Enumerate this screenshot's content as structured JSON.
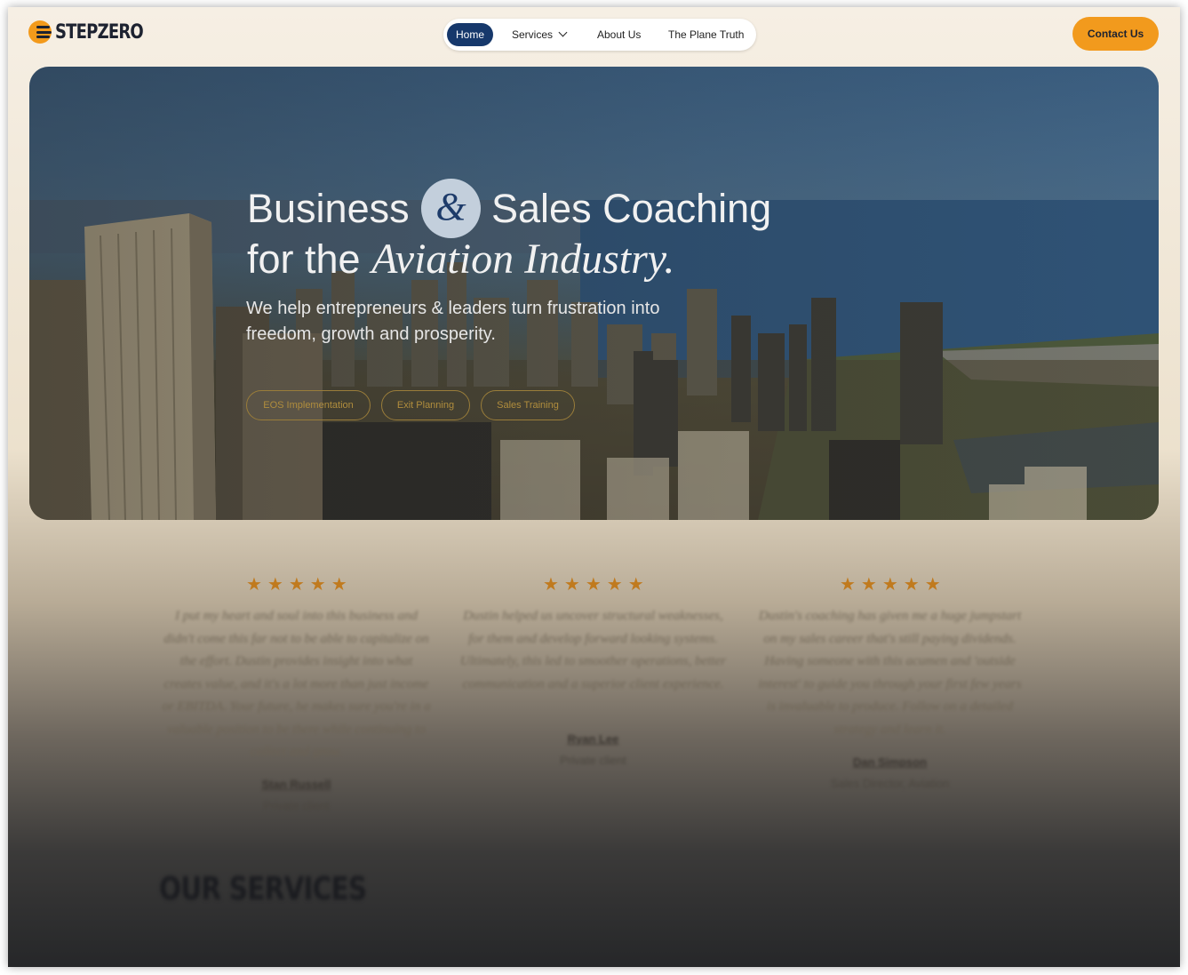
{
  "brand": {
    "name": "STEPZERO",
    "accent": "#f29a1d",
    "navy": "#16386b"
  },
  "nav": {
    "items": [
      {
        "label": "Home",
        "active": true
      },
      {
        "label": "Services",
        "has_dropdown": true
      },
      {
        "label": "About Us"
      },
      {
        "label": "The Plane Truth"
      }
    ]
  },
  "header": {
    "contact_label": "Contact Us"
  },
  "hero": {
    "line1_a": "Business",
    "ampersand": "&",
    "line1_b": "Sales Coaching",
    "line2_a": "for the",
    "line2_italic": "Aviation Industry.",
    "subtitle": "We help entrepreneurs & leaders turn frustration into freedom, growth and prosperity.",
    "pills": [
      "EOS Implementation",
      "Exit Planning",
      "Sales Training"
    ]
  },
  "testimonials": [
    {
      "stars": "★★★★★",
      "quote": "I put my heart and soul into this business and didn't come this far not to be able to capitalize on the effort. Dustin provides insight into what creates value, and it's a lot more than just income or EBITDA. Your future, he makes sure you're in a valuable position to be there while continuing to collect and grow.",
      "name": "Stan Russell",
      "role": "Private client"
    },
    {
      "stars": "★★★★★",
      "quote": "Dustin helped us uncover structural weaknesses, for them and develop forward looking systems. Ultimately, this led to smoother operations, better communication and a superior client experience.",
      "name": "Ryan Lee",
      "role": "Private client"
    },
    {
      "stars": "★★★★★",
      "quote": "Dustin's coaching has given me a huge jumpstart on my sales career that's still paying dividends. Having someone with this acumen and 'outside interest' to guide you through your first few years is invaluable to produce. Follow on a detailed strategy and learn it.",
      "name": "Dan Simpson",
      "role": "Sales Director, Aviation"
    }
  ],
  "services_heading": "OUR SERVICES"
}
